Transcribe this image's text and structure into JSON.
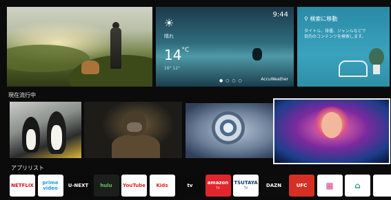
{
  "weather": {
    "condition": "晴れ",
    "temperature": "14",
    "unit": "°C",
    "hilo": "16°   12°",
    "time": "9:44",
    "brand": "AccuWeather"
  },
  "search": {
    "label": "検索に移動",
    "description": "タイトル、俳優、ジャンルなどで目的のコンテンツを検索します。"
  },
  "sections": {
    "trending": "現在流行中",
    "apps": "アプリリスト"
  },
  "apps": [
    {
      "label": "NETFLIX",
      "bg": "#ffffff",
      "color": "#e50914"
    },
    {
      "label": "prime video",
      "bg": "#ffffff",
      "color": "#1a98ff"
    },
    {
      "label": "U-NEXT",
      "bg": "#0a0a0a",
      "color": "#ffffff"
    },
    {
      "label": "hulu",
      "bg": "#1b1f1b",
      "color": "#67c167"
    },
    {
      "label": "YouTube",
      "bg": "#ffffff",
      "color": "#e01d1d"
    },
    {
      "label": "Kids",
      "bg": "#ffffff",
      "color": "#e01d1d"
    },
    {
      "label": "tv",
      "bg": "#0a0a0a",
      "color": "#ffffff"
    },
    {
      "label": "amazon",
      "sub": "TV",
      "bg": "#e2262e",
      "color": "#ffffff"
    },
    {
      "label": "TSUTAYA",
      "sub": "TV",
      "bg": "#ffffff",
      "color": "#15326e"
    },
    {
      "label": "DAZN",
      "bg": "#0c0c0c",
      "color": "#ffffff"
    },
    {
      "label": "UFC",
      "bg": "#d62f24",
      "color": "#ffffff"
    },
    {
      "label": "",
      "icon": "apps-grid-icon",
      "bg": "#ffffff",
      "color": "#d6408a"
    },
    {
      "label": "",
      "icon": "home-circle-icon",
      "bg": "#ffffff",
      "color": "#2b9f6f"
    },
    {
      "label": "",
      "bg": "#ffffff",
      "color": "#333333"
    }
  ]
}
